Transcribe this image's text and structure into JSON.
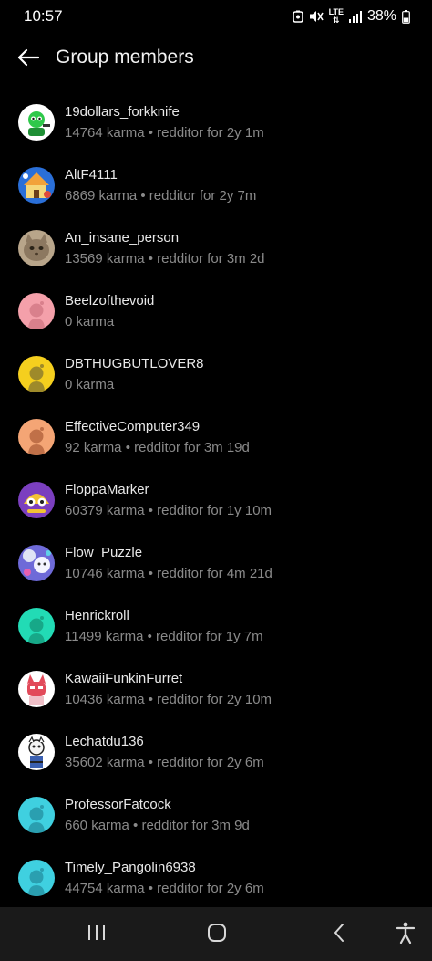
{
  "status": {
    "time": "10:57",
    "lte": "LTE",
    "battery": "38%"
  },
  "header": {
    "title": "Group members"
  },
  "members": [
    {
      "name": "19dollars_forkknife",
      "meta": "14764 karma • redditor for 2y 1m",
      "avatar_color": "#ffffff"
    },
    {
      "name": "AltF4111",
      "meta": "6869 karma • redditor for 2y 7m",
      "avatar_color": "#2a6fd8"
    },
    {
      "name": "An_insane_person",
      "meta": "13569 karma • redditor for 3m 2d",
      "avatar_color": "#9b8770"
    },
    {
      "name": "Beelzofthevoid",
      "meta": "0 karma",
      "avatar_color": "#f4a0aa"
    },
    {
      "name": "DBTHUGBUTLOVER8",
      "meta": "0 karma",
      "avatar_color": "#f5cf1e"
    },
    {
      "name": "EffectiveComputer349",
      "meta": "92 karma • redditor for 3m 19d",
      "avatar_color": "#f4a575"
    },
    {
      "name": "FloppaMarker",
      "meta": "60379 karma • redditor for 1y 10m",
      "avatar_color": "#7b3fbf"
    },
    {
      "name": "Flow_Puzzle",
      "meta": "10746 karma • redditor for 4m 21d",
      "avatar_color": "#6e6ad8"
    },
    {
      "name": "Henrickroll",
      "meta": "11499 karma • redditor for 1y 7m",
      "avatar_color": "#22dbb5"
    },
    {
      "name": "KawaiiFunkinFurret",
      "meta": "10436 karma • redditor for 2y 10m",
      "avatar_color": "#ffffff"
    },
    {
      "name": "Lechatdu136",
      "meta": "35602 karma • redditor for 2y 6m",
      "avatar_color": "#ffffff"
    },
    {
      "name": "ProfessorFatcock",
      "meta": "660 karma • redditor for 3m 9d",
      "avatar_color": "#3fd0e0"
    },
    {
      "name": "Timely_Pangolin6938",
      "meta": "44754 karma • redditor for 2y 6m",
      "avatar_color": "#3fd0e0"
    }
  ]
}
